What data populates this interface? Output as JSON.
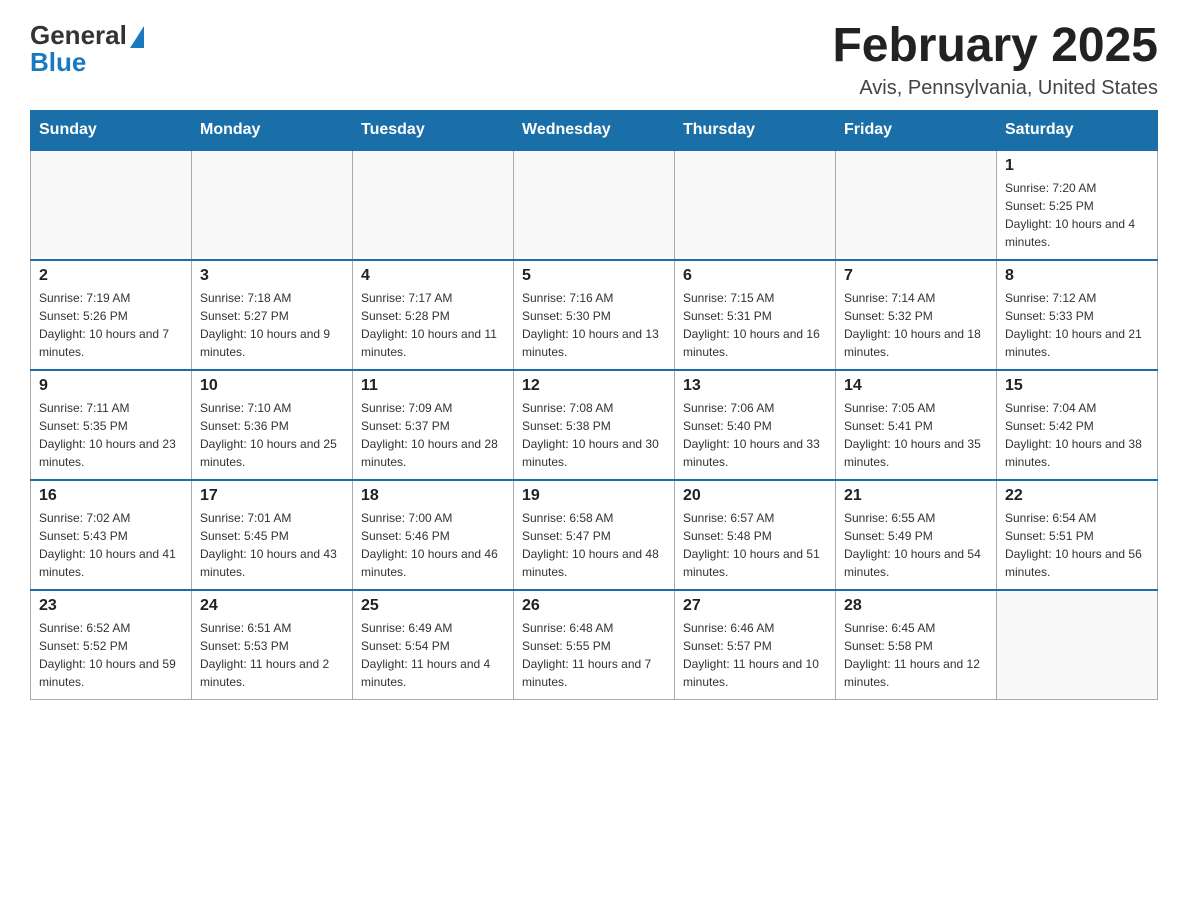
{
  "logo": {
    "general": "General",
    "blue": "Blue"
  },
  "title": "February 2025",
  "location": "Avis, Pennsylvania, United States",
  "days_header": [
    "Sunday",
    "Monday",
    "Tuesday",
    "Wednesday",
    "Thursday",
    "Friday",
    "Saturday"
  ],
  "weeks": [
    [
      {
        "day": "",
        "info": ""
      },
      {
        "day": "",
        "info": ""
      },
      {
        "day": "",
        "info": ""
      },
      {
        "day": "",
        "info": ""
      },
      {
        "day": "",
        "info": ""
      },
      {
        "day": "",
        "info": ""
      },
      {
        "day": "1",
        "info": "Sunrise: 7:20 AM\nSunset: 5:25 PM\nDaylight: 10 hours and 4 minutes."
      }
    ],
    [
      {
        "day": "2",
        "info": "Sunrise: 7:19 AM\nSunset: 5:26 PM\nDaylight: 10 hours and 7 minutes."
      },
      {
        "day": "3",
        "info": "Sunrise: 7:18 AM\nSunset: 5:27 PM\nDaylight: 10 hours and 9 minutes."
      },
      {
        "day": "4",
        "info": "Sunrise: 7:17 AM\nSunset: 5:28 PM\nDaylight: 10 hours and 11 minutes."
      },
      {
        "day": "5",
        "info": "Sunrise: 7:16 AM\nSunset: 5:30 PM\nDaylight: 10 hours and 13 minutes."
      },
      {
        "day": "6",
        "info": "Sunrise: 7:15 AM\nSunset: 5:31 PM\nDaylight: 10 hours and 16 minutes."
      },
      {
        "day": "7",
        "info": "Sunrise: 7:14 AM\nSunset: 5:32 PM\nDaylight: 10 hours and 18 minutes."
      },
      {
        "day": "8",
        "info": "Sunrise: 7:12 AM\nSunset: 5:33 PM\nDaylight: 10 hours and 21 minutes."
      }
    ],
    [
      {
        "day": "9",
        "info": "Sunrise: 7:11 AM\nSunset: 5:35 PM\nDaylight: 10 hours and 23 minutes."
      },
      {
        "day": "10",
        "info": "Sunrise: 7:10 AM\nSunset: 5:36 PM\nDaylight: 10 hours and 25 minutes."
      },
      {
        "day": "11",
        "info": "Sunrise: 7:09 AM\nSunset: 5:37 PM\nDaylight: 10 hours and 28 minutes."
      },
      {
        "day": "12",
        "info": "Sunrise: 7:08 AM\nSunset: 5:38 PM\nDaylight: 10 hours and 30 minutes."
      },
      {
        "day": "13",
        "info": "Sunrise: 7:06 AM\nSunset: 5:40 PM\nDaylight: 10 hours and 33 minutes."
      },
      {
        "day": "14",
        "info": "Sunrise: 7:05 AM\nSunset: 5:41 PM\nDaylight: 10 hours and 35 minutes."
      },
      {
        "day": "15",
        "info": "Sunrise: 7:04 AM\nSunset: 5:42 PM\nDaylight: 10 hours and 38 minutes."
      }
    ],
    [
      {
        "day": "16",
        "info": "Sunrise: 7:02 AM\nSunset: 5:43 PM\nDaylight: 10 hours and 41 minutes."
      },
      {
        "day": "17",
        "info": "Sunrise: 7:01 AM\nSunset: 5:45 PM\nDaylight: 10 hours and 43 minutes."
      },
      {
        "day": "18",
        "info": "Sunrise: 7:00 AM\nSunset: 5:46 PM\nDaylight: 10 hours and 46 minutes."
      },
      {
        "day": "19",
        "info": "Sunrise: 6:58 AM\nSunset: 5:47 PM\nDaylight: 10 hours and 48 minutes."
      },
      {
        "day": "20",
        "info": "Sunrise: 6:57 AM\nSunset: 5:48 PM\nDaylight: 10 hours and 51 minutes."
      },
      {
        "day": "21",
        "info": "Sunrise: 6:55 AM\nSunset: 5:49 PM\nDaylight: 10 hours and 54 minutes."
      },
      {
        "day": "22",
        "info": "Sunrise: 6:54 AM\nSunset: 5:51 PM\nDaylight: 10 hours and 56 minutes."
      }
    ],
    [
      {
        "day": "23",
        "info": "Sunrise: 6:52 AM\nSunset: 5:52 PM\nDaylight: 10 hours and 59 minutes."
      },
      {
        "day": "24",
        "info": "Sunrise: 6:51 AM\nSunset: 5:53 PM\nDaylight: 11 hours and 2 minutes."
      },
      {
        "day": "25",
        "info": "Sunrise: 6:49 AM\nSunset: 5:54 PM\nDaylight: 11 hours and 4 minutes."
      },
      {
        "day": "26",
        "info": "Sunrise: 6:48 AM\nSunset: 5:55 PM\nDaylight: 11 hours and 7 minutes."
      },
      {
        "day": "27",
        "info": "Sunrise: 6:46 AM\nSunset: 5:57 PM\nDaylight: 11 hours and 10 minutes."
      },
      {
        "day": "28",
        "info": "Sunrise: 6:45 AM\nSunset: 5:58 PM\nDaylight: 11 hours and 12 minutes."
      },
      {
        "day": "",
        "info": ""
      }
    ]
  ]
}
